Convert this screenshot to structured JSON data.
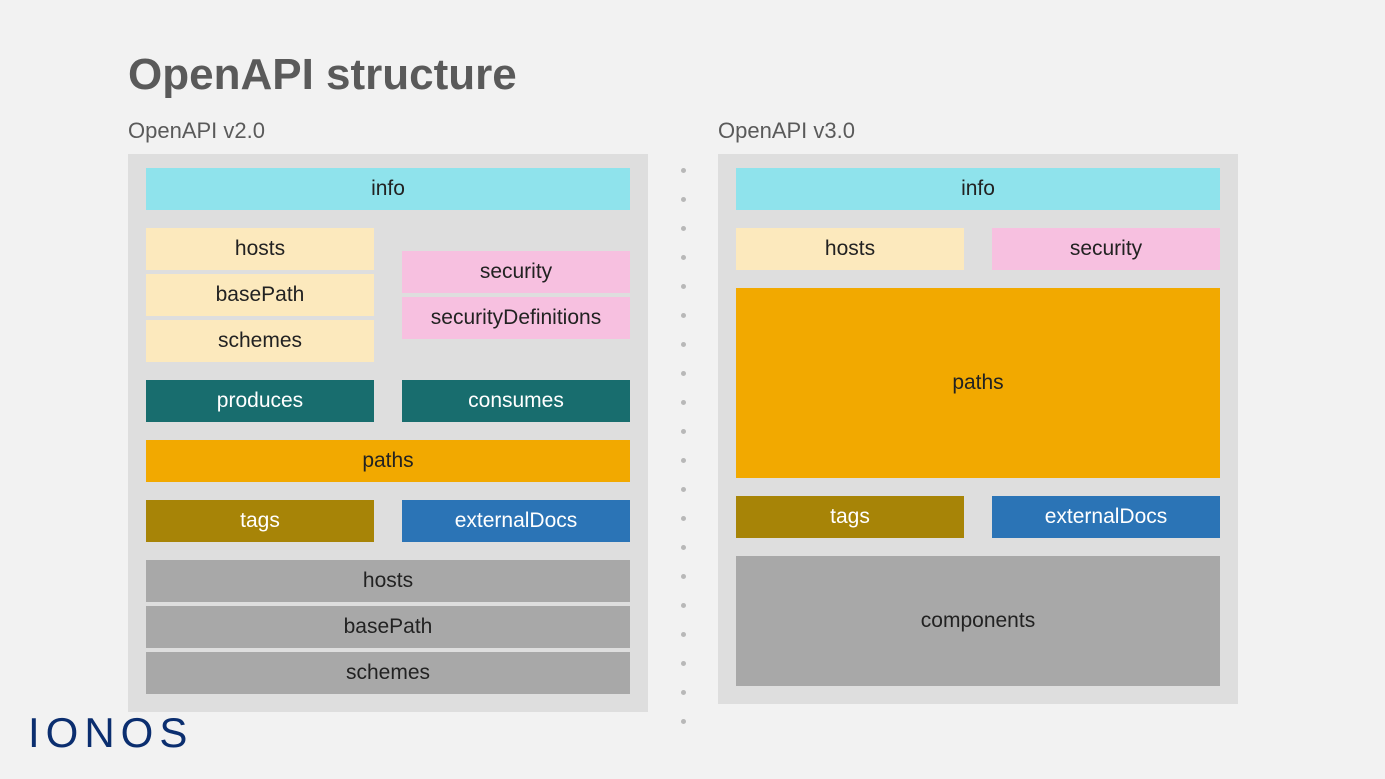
{
  "title": "OpenAPI structure",
  "logo": "IONOS",
  "v2": {
    "heading": "OpenAPI v2.0",
    "info": "info",
    "hosts": "hosts",
    "basePath": "basePath",
    "schemes": "schemes",
    "security": "security",
    "securityDefinitions": "securityDefinitions",
    "produces": "produces",
    "consumes": "consumes",
    "paths": "paths",
    "tags": "tags",
    "externalDocs": "externalDocs",
    "footer_hosts": "hosts",
    "footer_basePath": "basePath",
    "footer_schemes": "schemes"
  },
  "v3": {
    "heading": "OpenAPI v3.0",
    "info": "info",
    "hosts": "hosts",
    "security": "security",
    "paths": "paths",
    "tags": "tags",
    "externalDocs": "externalDocs",
    "components": "components"
  }
}
